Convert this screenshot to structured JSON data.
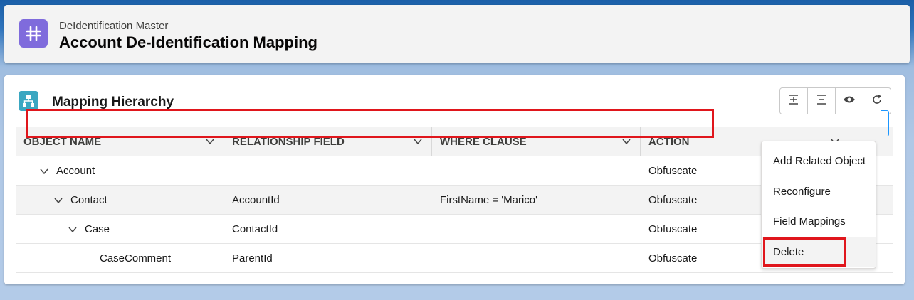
{
  "header": {
    "object_label": "DeIdentification Master",
    "record_title": "Account De-Identification Mapping",
    "icon": "hash-grid-icon",
    "icon_color": "#7f6bdc"
  },
  "card": {
    "title": "Mapping Hierarchy",
    "icon": "hierarchy-icon",
    "icon_color": "#3ba7c1",
    "toolbar": [
      {
        "name": "expand-all-icon"
      },
      {
        "name": "collapse-all-icon"
      },
      {
        "name": "eye-icon"
      },
      {
        "name": "refresh-icon"
      }
    ]
  },
  "table": {
    "columns": [
      "OBJECT NAME",
      "RELATIONSHIP FIELD",
      "WHERE CLAUSE",
      "ACTION"
    ],
    "rows": [
      {
        "object": "Account",
        "relationship": "",
        "where": "",
        "action": "Obfuscate",
        "level": 1,
        "expandable": true
      },
      {
        "object": "Contact",
        "relationship": "AccountId",
        "where": "FirstName = 'Marico'",
        "action": "Obfuscate",
        "level": 2,
        "expandable": true,
        "selected": true
      },
      {
        "object": "Case",
        "relationship": "ContactId",
        "where": "",
        "action": "Obfuscate",
        "level": 3,
        "expandable": true
      },
      {
        "object": "CaseComment",
        "relationship": "ParentId",
        "where": "",
        "action": "Obfuscate",
        "level": 4,
        "expandable": false
      }
    ]
  },
  "row_menu": {
    "items": [
      "Add Related Object",
      "Reconfigure",
      "Field Mappings",
      "Delete"
    ],
    "hovered": "Delete"
  },
  "highlight_color": "#e0161c"
}
